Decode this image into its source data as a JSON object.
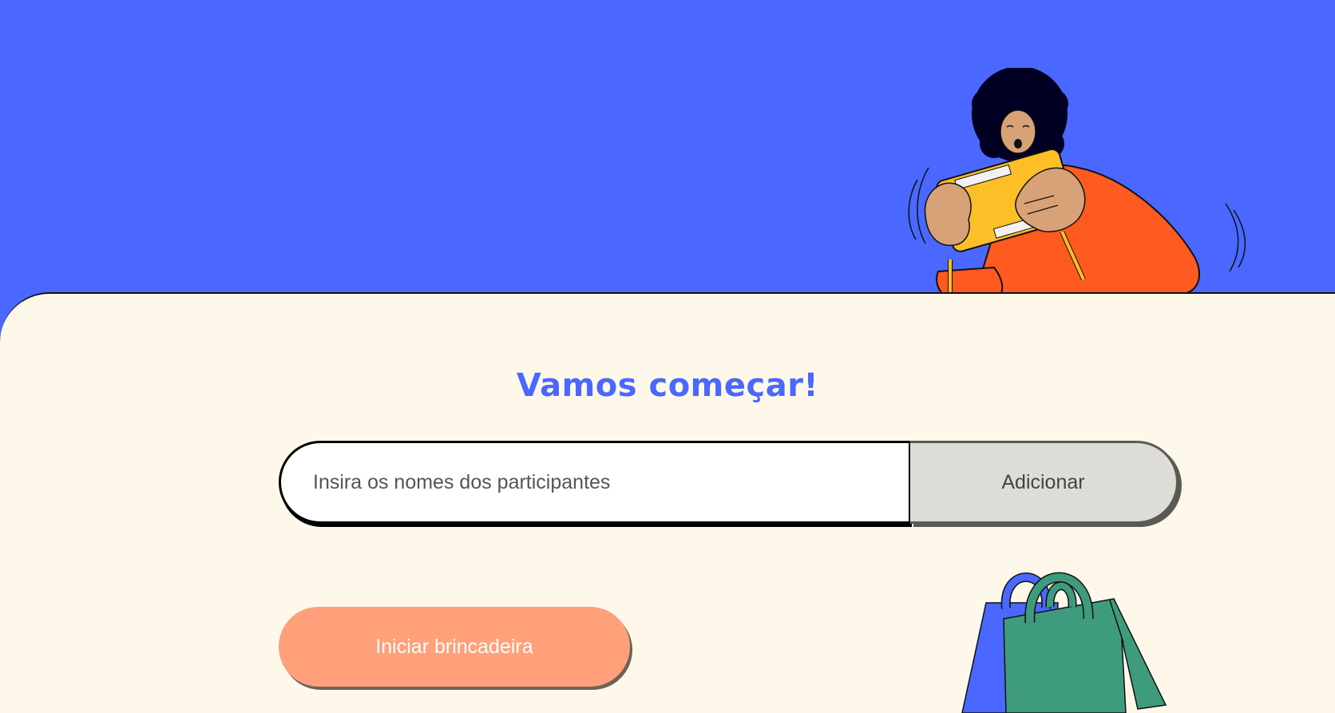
{
  "heading": "Vamos começar!",
  "participants_input": {
    "placeholder": "Insira os nomes dos participantes",
    "value": ""
  },
  "add_button_label": "Adicionar",
  "start_button_label": "Iniciar brincadeira",
  "illustrations": {
    "person": "person-playing-handheld-console",
    "bags": "shopping-bags"
  },
  "colors": {
    "primary_blue": "#4a68ff",
    "cream": "#fef8ea",
    "orange": "#ff5a1f",
    "peach_button": "#ffa07a",
    "green_bag": "#3f9b7e",
    "console_yellow": "#fdbf27"
  }
}
